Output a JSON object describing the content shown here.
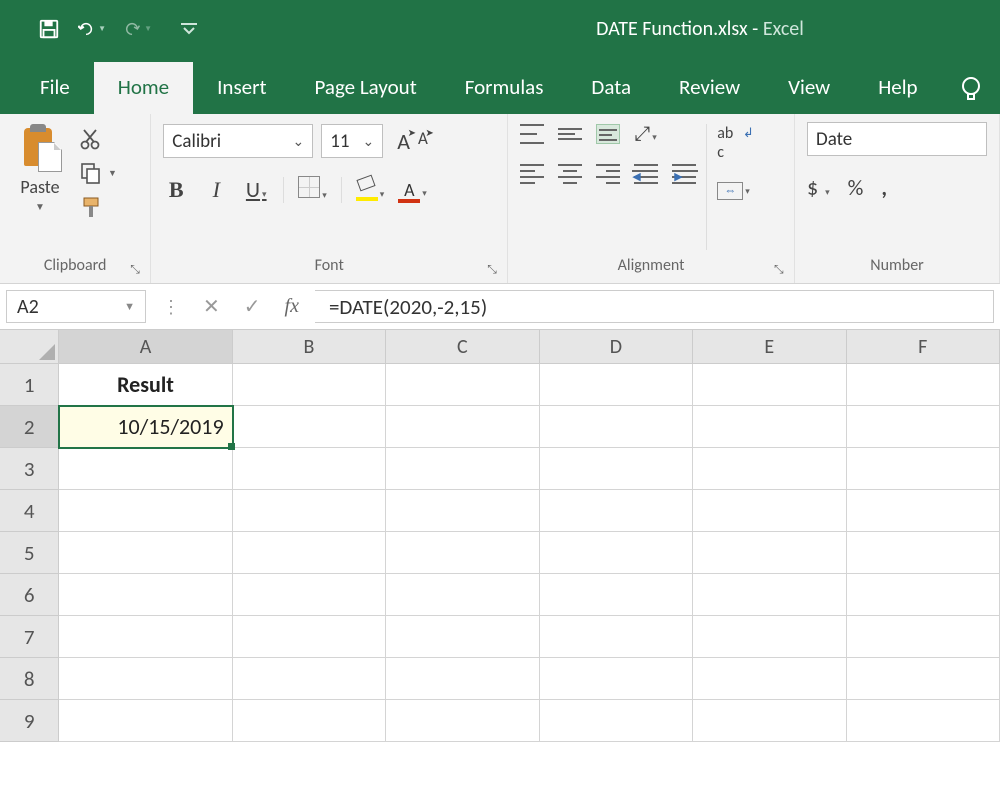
{
  "title": {
    "doc": "DATE Function.xlsx",
    "sep": "  -  ",
    "app": "Excel"
  },
  "qat": {
    "undo": "↶",
    "redo": "↷"
  },
  "tabs": [
    "File",
    "Home",
    "Insert",
    "Page Layout",
    "Formulas",
    "Data",
    "Review",
    "View",
    "Help"
  ],
  "active_tab": "Home",
  "ribbon": {
    "clipboard": {
      "label": "Clipboard",
      "paste": "Paste"
    },
    "font": {
      "label": "Font",
      "name": "Calibri",
      "size": "11",
      "buttons": {
        "bold": "B",
        "italic": "I",
        "underline": "U",
        "fontcolor_letter": "A"
      }
    },
    "alignment": {
      "label": "Alignment"
    },
    "number": {
      "label": "Number",
      "format": "Date",
      "currency": "$",
      "percent": "%",
      "comma": ","
    }
  },
  "formula_bar": {
    "name_box": "A2",
    "fx": "fx",
    "formula": "=DATE(2020,-2,15)"
  },
  "grid": {
    "columns": [
      "A",
      "B",
      "C",
      "D",
      "E",
      "F"
    ],
    "rows": [
      "1",
      "2",
      "3",
      "4",
      "5",
      "6",
      "7",
      "8",
      "9"
    ],
    "cells": {
      "A1": "Result",
      "A2": "10/15/2019"
    },
    "selected": "A2"
  }
}
